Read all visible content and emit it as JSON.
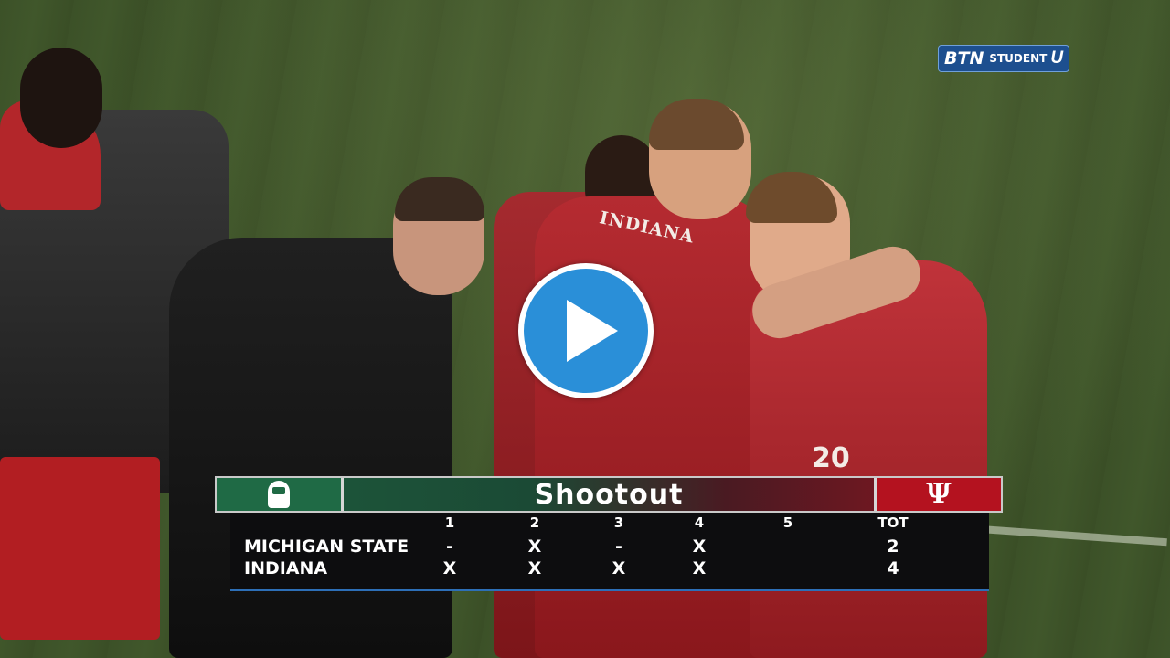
{
  "watermark": {
    "brand": "BTN",
    "sub": "STUDENT",
    "letter": "U"
  },
  "scene": {
    "jersey_text": "INDIANA",
    "jersey_number": "20"
  },
  "scoreboard": {
    "title": "Shootout",
    "columns": [
      "1",
      "2",
      "3",
      "4",
      "5",
      "TOT"
    ],
    "rows": [
      {
        "team": "MICHIGAN STATE",
        "cells": [
          "-",
          "X",
          "-",
          "X",
          "",
          "2"
        ]
      },
      {
        "team": "INDIANA",
        "cells": [
          "X",
          "X",
          "X",
          "X",
          "",
          "4"
        ]
      }
    ],
    "colors": {
      "left_team": "#1f6a45",
      "right_team": "#b4121f",
      "accent": "#2d6fb7"
    }
  },
  "player": {
    "play_icon": "play-icon",
    "play_color": "#2a8fd8"
  }
}
